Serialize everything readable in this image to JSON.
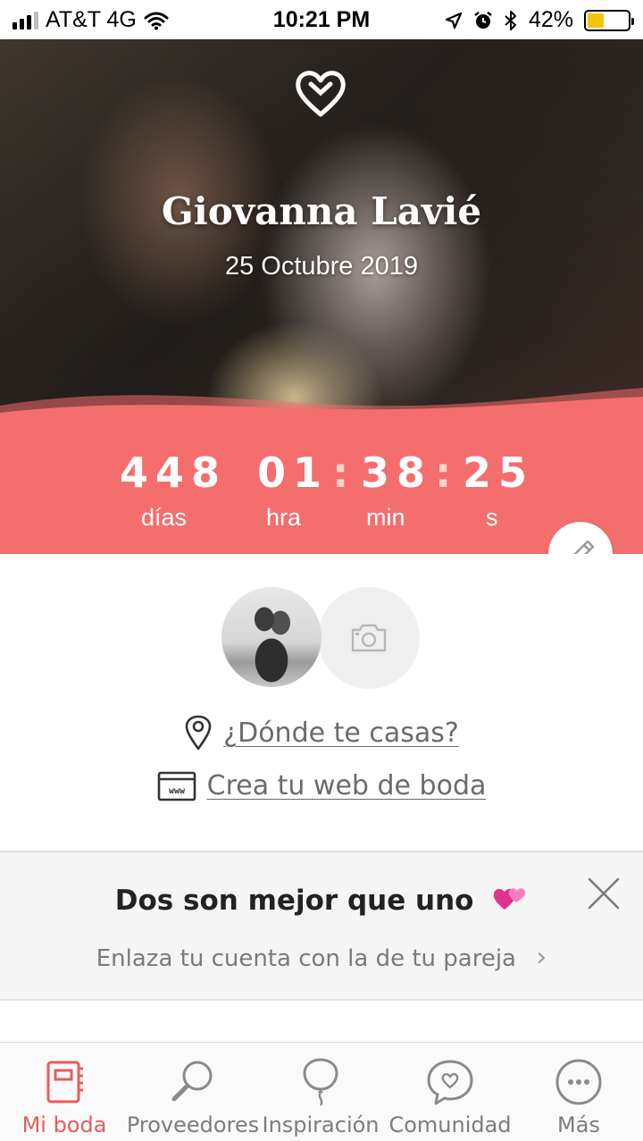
{
  "status_bar": {
    "carrier": "AT&T 4G",
    "time": "10:21 PM",
    "battery_percent": "42%",
    "battery_level": 0.42,
    "signal_bars": 3,
    "icons": [
      "signal-bars-icon",
      "wifi-icon",
      "location-arrow-icon",
      "alarm-icon",
      "bluetooth-icon",
      "battery-icon"
    ]
  },
  "hero": {
    "names": "Giovanna Lavié",
    "date": "25 Octubre 2019",
    "logo_icon": "heart-icon",
    "edit_icon": "pencil-icon"
  },
  "countdown": {
    "days": "448",
    "hours": "01",
    "minutes": "38",
    "seconds": "25",
    "separator": ":",
    "days_label": "días",
    "hours_label": "hra",
    "minutes_label": "min",
    "seconds_label": "s",
    "band_color": "#f46e6e"
  },
  "profile": {
    "photo_placeholder_icon": "camera-icon"
  },
  "links": {
    "venue": "¿Dónde te casas?",
    "venue_icon": "location-pin-icon",
    "website": "Crea tu web de boda",
    "website_icon": "browser-window-icon"
  },
  "promo": {
    "title": "Dos son mejor que uno",
    "title_icon": "two-hearts-icon",
    "subtitle": "Enlaza tu cuenta con la de tu pareja",
    "chevron": "›",
    "close_icon": "close-icon"
  },
  "tabbar": {
    "active_color": "#e85c5c",
    "tabs": [
      {
        "label": "Mi boda",
        "icon": "planner-book-icon",
        "active": true
      },
      {
        "label": "Proveedores",
        "icon": "magnifier-icon",
        "active": false
      },
      {
        "label": "Inspiración",
        "icon": "balloon-icon",
        "active": false
      },
      {
        "label": "Comunidad",
        "icon": "heart-chat-bubble-icon",
        "active": false
      },
      {
        "label": "Más",
        "icon": "more-dots-icon",
        "active": false
      }
    ]
  }
}
